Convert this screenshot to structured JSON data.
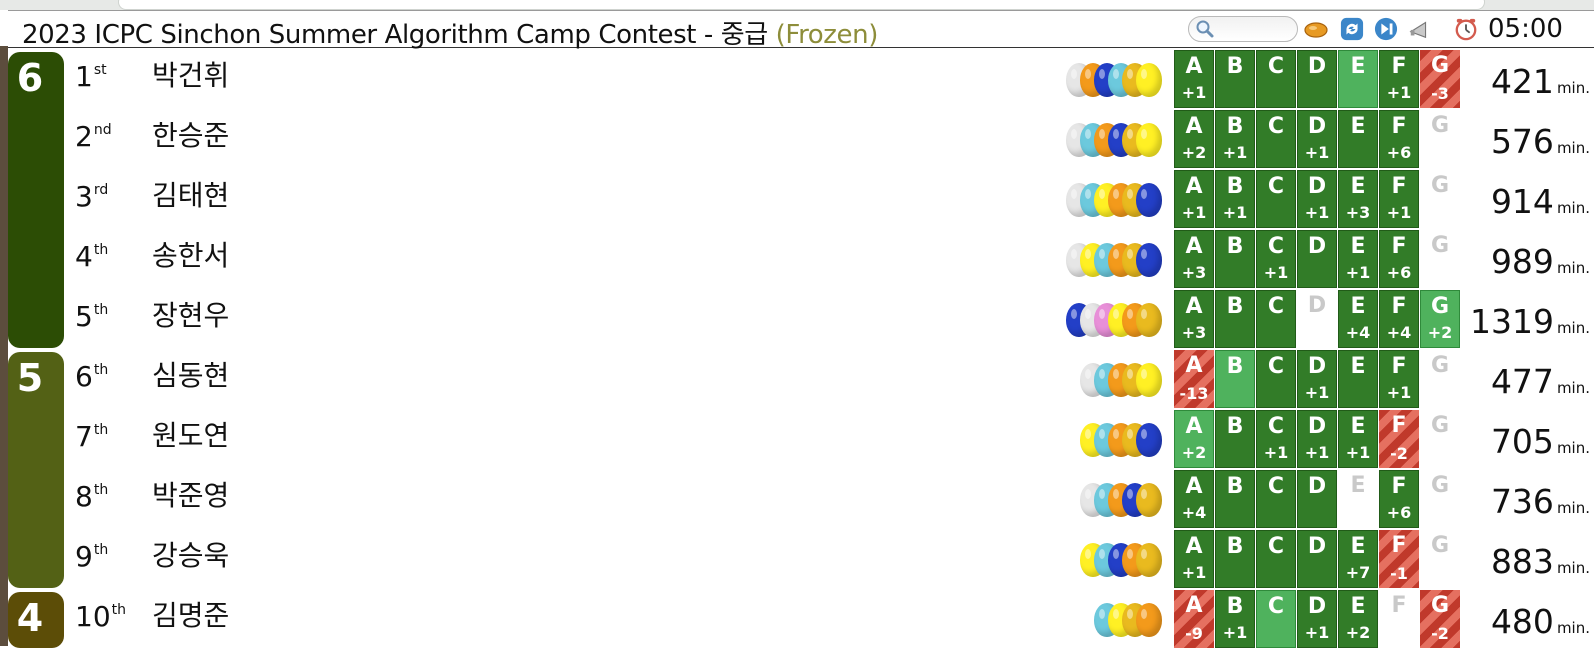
{
  "header": {
    "title": "2023 ICPC Sinchon Summer Algorithm Camp Contest - 중급",
    "status": "(Frozen)",
    "timer": "05:00",
    "search_placeholder": ""
  },
  "toolbar": {
    "icons": [
      "search-icon",
      "balloon-toggle-icon",
      "refresh-icon",
      "skip-forward-icon",
      "announce-icon",
      "clock-icon"
    ]
  },
  "colors": {
    "solved": "#327c28",
    "first_solve": "#4fb25d",
    "failed": "#c0392b",
    "group6": "#2c4d05",
    "group5": "#536115",
    "group4": "#5c4d07"
  },
  "groups": [
    {
      "label": "6",
      "color": "#2c4d05"
    },
    {
      "label": "5",
      "color": "#536115"
    },
    {
      "label": "4",
      "color": "#5c4d07"
    }
  ],
  "problems": [
    "A",
    "B",
    "C",
    "D",
    "E",
    "F",
    "G"
  ],
  "rows": [
    {
      "rank": "1",
      "suffix": "st",
      "name": "박건휘",
      "score": "421",
      "unit": "min.",
      "balloons": [
        "#e6e6e6",
        "#f39a1b",
        "#233fc7",
        "#6cc9dd",
        "#e9ba1f",
        "#fff024"
      ],
      "cells": [
        {
          "s": "solved",
          "t": "+1"
        },
        {
          "s": "solved",
          "t": ""
        },
        {
          "s": "solved",
          "t": ""
        },
        {
          "s": "solved",
          "t": ""
        },
        {
          "s": "first",
          "t": ""
        },
        {
          "s": "solved",
          "t": "+1"
        },
        {
          "s": "fail",
          "t": "-3"
        }
      ]
    },
    {
      "rank": "2",
      "suffix": "nd",
      "name": "한승준",
      "score": "576",
      "unit": "min.",
      "balloons": [
        "#e6e6e6",
        "#6cc9dd",
        "#f39a1b",
        "#233fc7",
        "#e9ba1f",
        "#fff024"
      ],
      "cells": [
        {
          "s": "solved",
          "t": "+2"
        },
        {
          "s": "solved",
          "t": "+1"
        },
        {
          "s": "solved",
          "t": ""
        },
        {
          "s": "solved",
          "t": "+1"
        },
        {
          "s": "solved",
          "t": ""
        },
        {
          "s": "solved",
          "t": "+6"
        },
        {
          "s": "none",
          "t": ""
        }
      ]
    },
    {
      "rank": "3",
      "suffix": "rd",
      "name": "김태현",
      "score": "914",
      "unit": "min.",
      "balloons": [
        "#e6e6e6",
        "#6cc9dd",
        "#fff024",
        "#f39a1b",
        "#e9ba1f",
        "#233fc7"
      ],
      "cells": [
        {
          "s": "solved",
          "t": "+1"
        },
        {
          "s": "solved",
          "t": "+1"
        },
        {
          "s": "solved",
          "t": ""
        },
        {
          "s": "solved",
          "t": "+1"
        },
        {
          "s": "solved",
          "t": "+3"
        },
        {
          "s": "solved",
          "t": "+1"
        },
        {
          "s": "none",
          "t": ""
        }
      ]
    },
    {
      "rank": "4",
      "suffix": "th",
      "name": "송한서",
      "score": "989",
      "unit": "min.",
      "balloons": [
        "#e6e6e6",
        "#fff024",
        "#6cc9dd",
        "#f39a1b",
        "#e9ba1f",
        "#233fc7"
      ],
      "cells": [
        {
          "s": "solved",
          "t": "+3"
        },
        {
          "s": "solved",
          "t": ""
        },
        {
          "s": "solved",
          "t": "+1"
        },
        {
          "s": "solved",
          "t": ""
        },
        {
          "s": "solved",
          "t": "+1"
        },
        {
          "s": "solved",
          "t": "+6"
        },
        {
          "s": "none",
          "t": ""
        }
      ]
    },
    {
      "rank": "5",
      "suffix": "th",
      "name": "장현우",
      "score": "1319",
      "unit": "min.",
      "balloons": [
        "#233fc7",
        "#e6e6e6",
        "#e88fd8",
        "#fff024",
        "#f39a1b",
        "#e9ba1f"
      ],
      "cells": [
        {
          "s": "solved",
          "t": "+3"
        },
        {
          "s": "solved",
          "t": ""
        },
        {
          "s": "solved",
          "t": ""
        },
        {
          "s": "none",
          "t": ""
        },
        {
          "s": "solved",
          "t": "+4"
        },
        {
          "s": "solved",
          "t": "+4"
        },
        {
          "s": "first",
          "t": "+2"
        }
      ]
    },
    {
      "rank": "6",
      "suffix": "th",
      "name": "심동현",
      "score": "477",
      "unit": "min.",
      "balloons": [
        "#e6e6e6",
        "#6cc9dd",
        "#f39a1b",
        "#e9ba1f",
        "#fff024"
      ],
      "cells": [
        {
          "s": "fail",
          "t": "-13"
        },
        {
          "s": "first",
          "t": ""
        },
        {
          "s": "solved",
          "t": ""
        },
        {
          "s": "solved",
          "t": "+1"
        },
        {
          "s": "solved",
          "t": ""
        },
        {
          "s": "solved",
          "t": "+1"
        },
        {
          "s": "none",
          "t": ""
        }
      ]
    },
    {
      "rank": "7",
      "suffix": "th",
      "name": "원도연",
      "score": "705",
      "unit": "min.",
      "balloons": [
        "#fff024",
        "#6cc9dd",
        "#f39a1b",
        "#e9ba1f",
        "#233fc7"
      ],
      "cells": [
        {
          "s": "first",
          "t": "+2"
        },
        {
          "s": "solved",
          "t": ""
        },
        {
          "s": "solved",
          "t": "+1"
        },
        {
          "s": "solved",
          "t": "+1"
        },
        {
          "s": "solved",
          "t": "+1"
        },
        {
          "s": "fail",
          "t": "-2"
        },
        {
          "s": "none",
          "t": ""
        }
      ]
    },
    {
      "rank": "8",
      "suffix": "th",
      "name": "박준영",
      "score": "736",
      "unit": "min.",
      "balloons": [
        "#e6e6e6",
        "#6cc9dd",
        "#f39a1b",
        "#233fc7",
        "#e9ba1f"
      ],
      "cells": [
        {
          "s": "solved",
          "t": "+4"
        },
        {
          "s": "solved",
          "t": ""
        },
        {
          "s": "solved",
          "t": ""
        },
        {
          "s": "solved",
          "t": ""
        },
        {
          "s": "none",
          "t": ""
        },
        {
          "s": "solved",
          "t": "+6"
        },
        {
          "s": "none",
          "t": ""
        }
      ]
    },
    {
      "rank": "9",
      "suffix": "th",
      "name": "강승욱",
      "score": "883",
      "unit": "min.",
      "balloons": [
        "#fff024",
        "#6cc9dd",
        "#233fc7",
        "#f39a1b",
        "#e9ba1f"
      ],
      "cells": [
        {
          "s": "solved",
          "t": "+1"
        },
        {
          "s": "solved",
          "t": ""
        },
        {
          "s": "solved",
          "t": ""
        },
        {
          "s": "solved",
          "t": ""
        },
        {
          "s": "solved",
          "t": "+7"
        },
        {
          "s": "fail",
          "t": "-1"
        },
        {
          "s": "none",
          "t": ""
        }
      ]
    },
    {
      "rank": "10",
      "suffix": "th",
      "name": "김명준",
      "score": "480",
      "unit": "min.",
      "balloons": [
        "#6cc9dd",
        "#fff024",
        "#e9ba1f",
        "#f39a1b"
      ],
      "cells": [
        {
          "s": "fail",
          "t": "-9"
        },
        {
          "s": "solved",
          "t": "+1"
        },
        {
          "s": "first",
          "t": ""
        },
        {
          "s": "solved",
          "t": "+1"
        },
        {
          "s": "solved",
          "t": "+2"
        },
        {
          "s": "none",
          "t": ""
        },
        {
          "s": "fail",
          "t": "-2"
        }
      ]
    }
  ]
}
